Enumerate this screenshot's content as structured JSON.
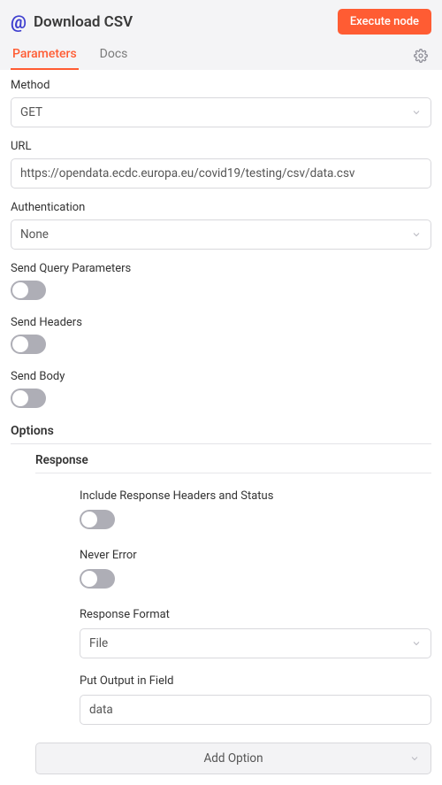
{
  "header": {
    "title": "Download CSV",
    "execute_label": "Execute node"
  },
  "tabs": {
    "parameters": "Parameters",
    "docs": "Docs"
  },
  "fields": {
    "method": {
      "label": "Method",
      "value": "GET"
    },
    "url": {
      "label": "URL",
      "value": "https://opendata.ecdc.europa.eu/covid19/testing/csv/data.csv"
    },
    "authentication": {
      "label": "Authentication",
      "value": "None"
    },
    "send_query": {
      "label": "Send Query Parameters",
      "value": false
    },
    "send_headers": {
      "label": "Send Headers",
      "value": false
    },
    "send_body": {
      "label": "Send Body",
      "value": false
    }
  },
  "options": {
    "label": "Options",
    "response": {
      "title": "Response",
      "include_headers": {
        "label": "Include Response Headers and Status",
        "value": false
      },
      "never_error": {
        "label": "Never Error",
        "value": false
      },
      "response_format": {
        "label": "Response Format",
        "value": "File"
      },
      "output_field": {
        "label": "Put Output in Field",
        "value": "data"
      }
    },
    "add_option_label": "Add Option"
  }
}
